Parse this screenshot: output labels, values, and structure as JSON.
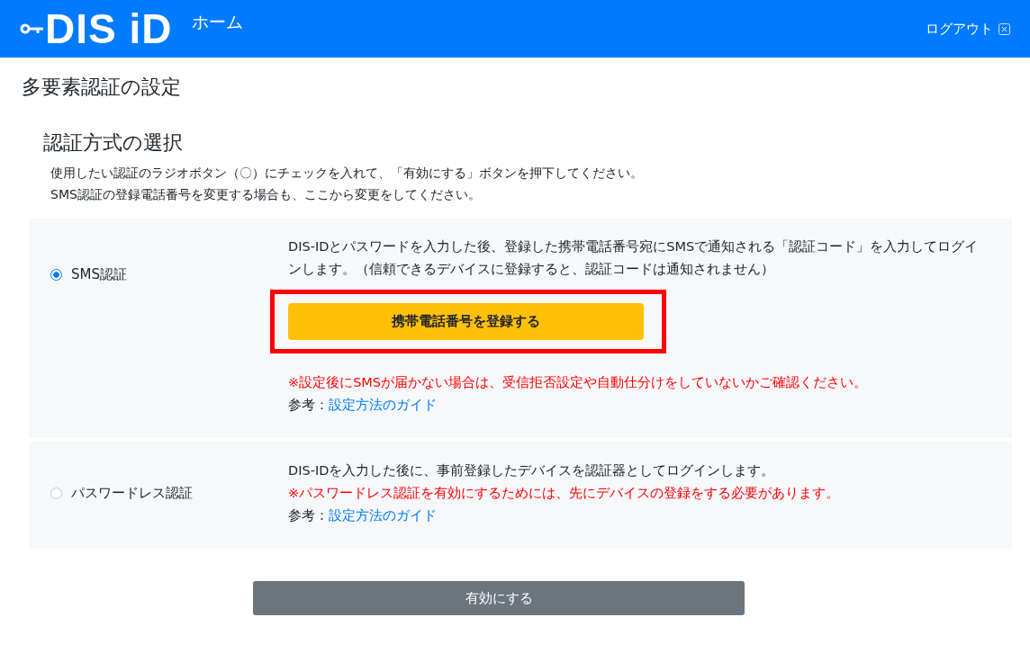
{
  "header": {
    "logo": "DIS iD",
    "home_link": "ホーム",
    "logout_link": "ログアウト"
  },
  "page_title": "多要素認証の設定",
  "section": {
    "heading": "認証方式の選択",
    "instructions": [
      "使用したい認証のラジオボタン（〇）にチェックを入れて、「有効にする」ボタンを押下してください。",
      "SMS認証の登録電話番号を変更する場合も、ここから変更をしてください。"
    ]
  },
  "methods": [
    {
      "label": "SMS認証",
      "selected": true,
      "description": "DIS-IDとパスワードを入力した後、登録した携帯電話番号宛にSMSで通知される「認証コード」を入力してログインします。（信頼できるデバイスに登録すると、認証コードは通知されません）",
      "action_button": "携帯電話番号を登録する",
      "highlighted": true,
      "warning": "※設定後にSMSが届かない場合は、受信拒否設定や自動仕分けをしていないかご確認ください。",
      "reference_label": "参考：",
      "reference_link": "設定方法のガイド"
    },
    {
      "label": "パスワードレス認証",
      "selected": false,
      "description": "DIS-IDを入力した後に、事前登録したデバイスを認証器としてログインします。",
      "warning": "※パスワードレス認証を有効にするためには、先にデバイスの登録をする必要があります。",
      "reference_label": "参考：",
      "reference_link": "設定方法のガイド"
    }
  ],
  "submit_button": "有効にする"
}
